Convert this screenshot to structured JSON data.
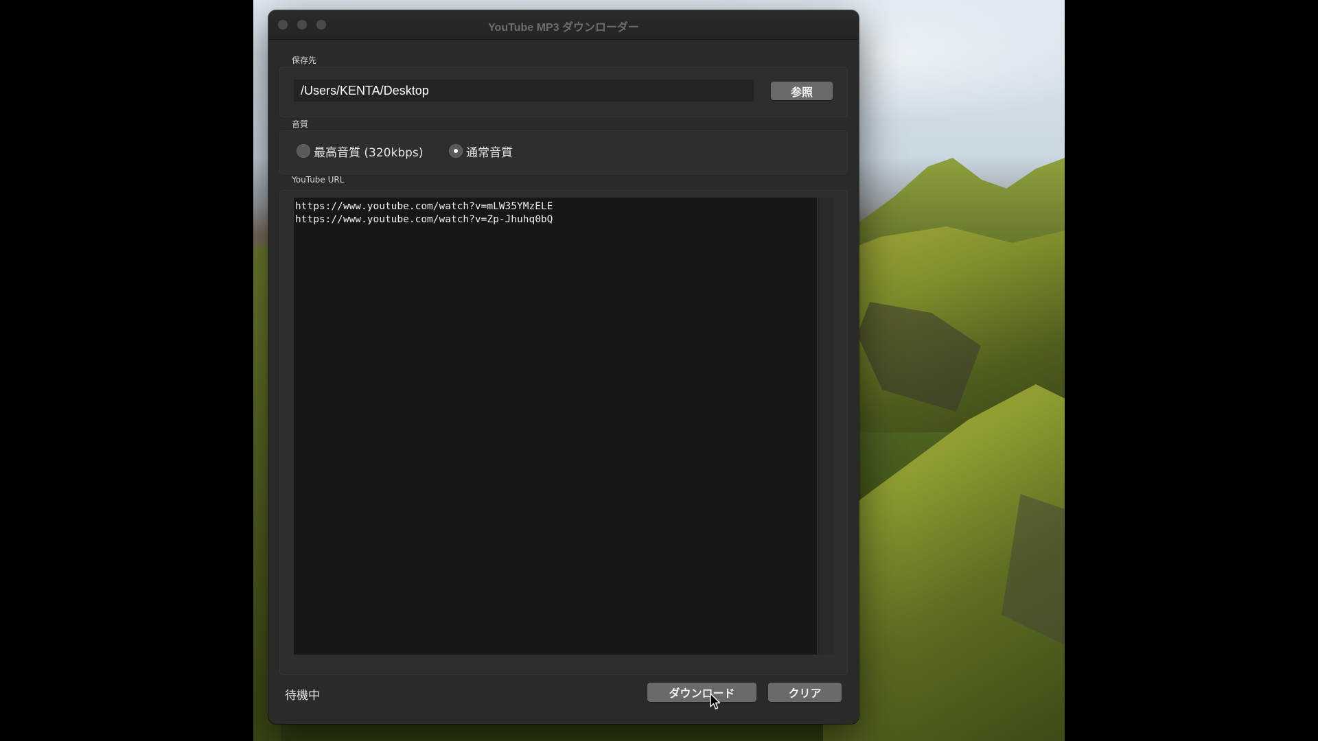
{
  "window": {
    "title": "YouTube MP3 ダウンローダー"
  },
  "save": {
    "label": "保存先",
    "path_value": "/Users/KENTA/Desktop",
    "browse_label": "参照"
  },
  "quality": {
    "label": "音質",
    "options": [
      {
        "label": "最高音質 (320kbps)",
        "selected": false
      },
      {
        "label": "通常音質",
        "selected": true
      }
    ]
  },
  "url": {
    "label": "YouTube URL",
    "text": "https://www.youtube.com/watch?v=mLW35YMzELE\nhttps://www.youtube.com/watch?v=Zp-Jhuhq0bQ"
  },
  "footer": {
    "status": "待機中",
    "download_label": "ダウンロード",
    "clear_label": "クリア"
  },
  "icons": {
    "close": "close-icon",
    "minimize": "minimize-icon",
    "zoom": "zoom-icon",
    "cursor": "mouse-pointer-icon"
  }
}
